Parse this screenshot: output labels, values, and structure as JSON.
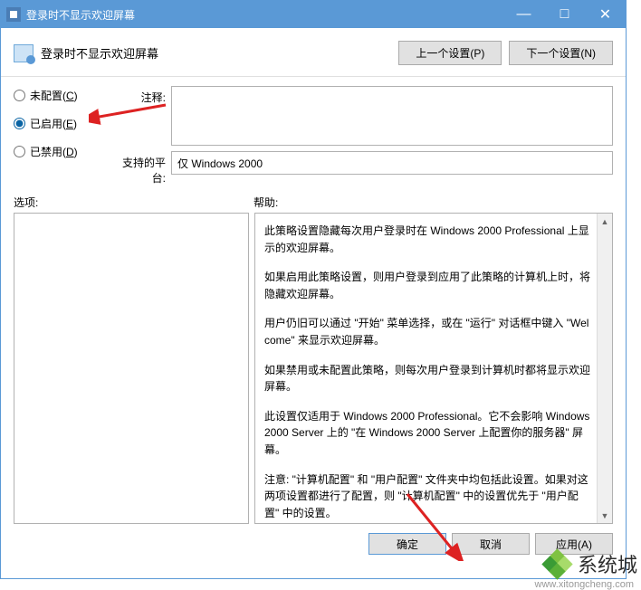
{
  "window": {
    "title": "登录时不显示欢迎屏幕",
    "minimize": "—",
    "maximize": "□",
    "close": "✕"
  },
  "header": {
    "title": "登录时不显示欢迎屏幕",
    "prev_btn": "上一个设置(P)",
    "next_btn": "下一个设置(N)"
  },
  "radios": {
    "not_configured": {
      "label": "未配置(",
      "accel": "C",
      "suffix": ")"
    },
    "enabled": {
      "label": "已启用(",
      "accel": "E",
      "suffix": ")"
    },
    "disabled": {
      "label": "已禁用(",
      "accel": "D",
      "suffix": ")"
    }
  },
  "fields": {
    "comment_label": "注释:",
    "comment_value": "",
    "platform_label": "支持的平台:",
    "platform_value": "仅 Windows 2000"
  },
  "sections": {
    "options_label": "选项:",
    "help_label": "帮助:"
  },
  "help": {
    "p1": "此策略设置隐藏每次用户登录时在 Windows 2000 Professional 上显示的欢迎屏幕。",
    "p2": "如果启用此策略设置，则用户登录到应用了此策略的计算机上时，将隐藏欢迎屏幕。",
    "p3": "用户仍旧可以通过 \"开始\" 菜单选择，或在 \"运行\" 对话框中键入 \"Welcome\" 来显示欢迎屏幕。",
    "p4": "如果禁用或未配置此策略，则每次用户登录到计算机时都将显示欢迎屏幕。",
    "p5": "此设置仅适用于 Windows 2000 Professional。它不会影响 Windows 2000 Server 上的 \"在 Windows 2000 Server 上配置你的服务器\" 屏幕。",
    "p6": "注意: \"计算机配置\" 和 \"用户配置\" 文件夹中均包括此设置。如果对这两项设置都进行了配置，则 \"计算机配置\" 中的设置优先于 \"用户配置\" 中的设置。"
  },
  "footer": {
    "ok": "确定",
    "cancel": "取消",
    "apply": "应用(A)"
  },
  "watermark": {
    "text": "系统城",
    "url": "www.xitongcheng.com"
  }
}
